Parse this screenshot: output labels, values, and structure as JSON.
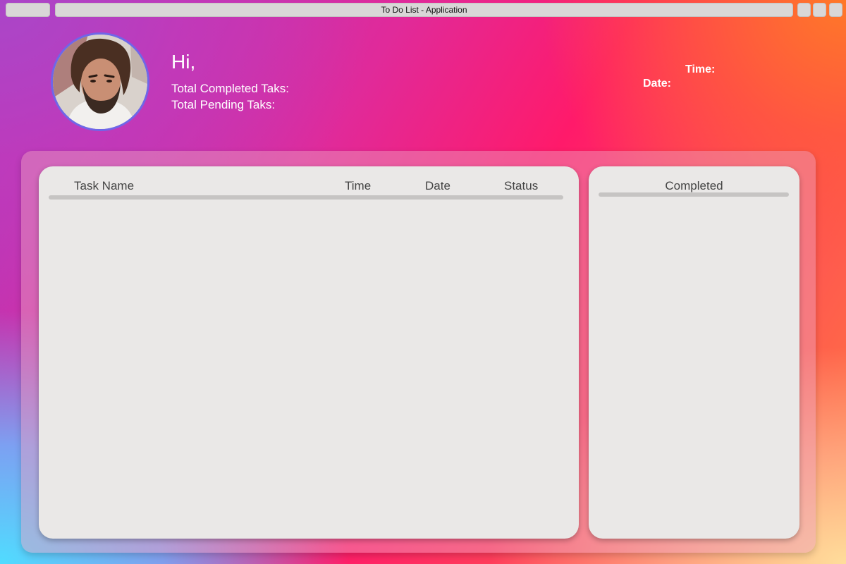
{
  "window": {
    "title": "To Do List - Application"
  },
  "header": {
    "greeting": "Hi,",
    "completed_label": "Total Completed Taks:",
    "pending_label": "Total Pending Taks:",
    "time_label": "Time:",
    "date_label": "Date:"
  },
  "tasks_table": {
    "columns": [
      "Task Name",
      "Time",
      "Date",
      "Status"
    ],
    "rows": []
  },
  "completed_panel": {
    "title": "Completed",
    "items": []
  },
  "colors": {
    "avatar_border": "#6f66e8",
    "card_background": "#eae8e7",
    "header_text": "#ffffff"
  }
}
